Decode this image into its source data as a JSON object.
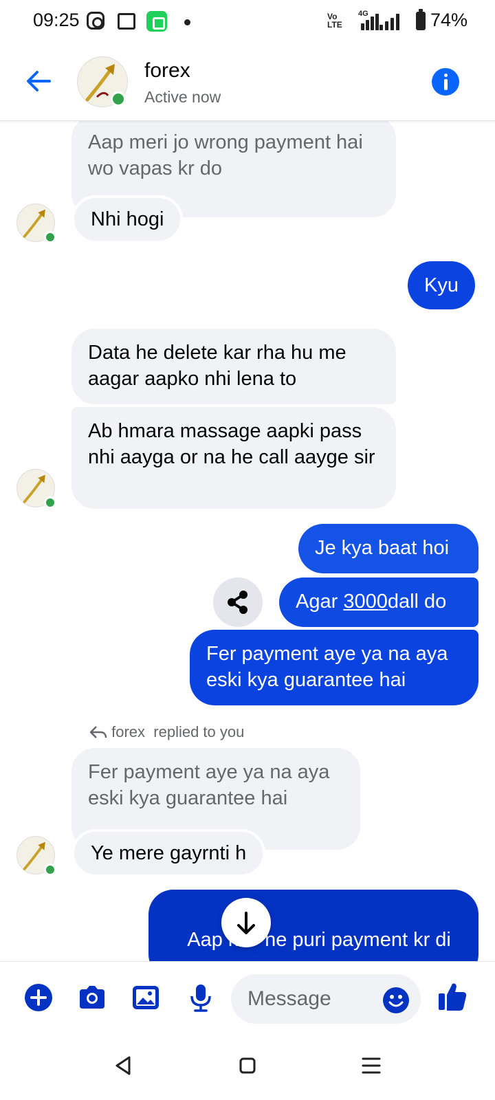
{
  "status_bar": {
    "time": "09:25",
    "volte": "Vo\nLTE",
    "network": "4G",
    "battery": "74%"
  },
  "header": {
    "contact_name": "forex",
    "contact_status": "Active now"
  },
  "messages": {
    "m1": "Aap meri jo wrong payment hai wo vapas kr do",
    "m2": "Nhi hogi",
    "m3": "Kyu",
    "m4": "Data he delete kar rha hu me aagar aapko nhi lena to",
    "m5": "Ab hmara massage aapki pass nhi aayga or na he call aayge sir",
    "m6": "Je kya baat hoi",
    "m7_prefix": "Agar ",
    "m7_link": "3000",
    "m7_suffix": "dall do",
    "m8": "Fer payment aye ya na aya eski kya guarantee hai",
    "reply_sender": "forex",
    "reply_text": "replied to you",
    "m9_quote": "Fer payment aye ya na aya eski kya guarantee hai",
    "m9": "Ye mere gayrnti h",
    "m10": "Aap ki    ne puri payment kr di"
  },
  "composer": {
    "placeholder": "Message"
  },
  "colors": {
    "accent": "#0866ff",
    "outgoing_bubble": "#0a43e0",
    "incoming_bubble": "#f0f2f5",
    "online": "#31a24c"
  }
}
